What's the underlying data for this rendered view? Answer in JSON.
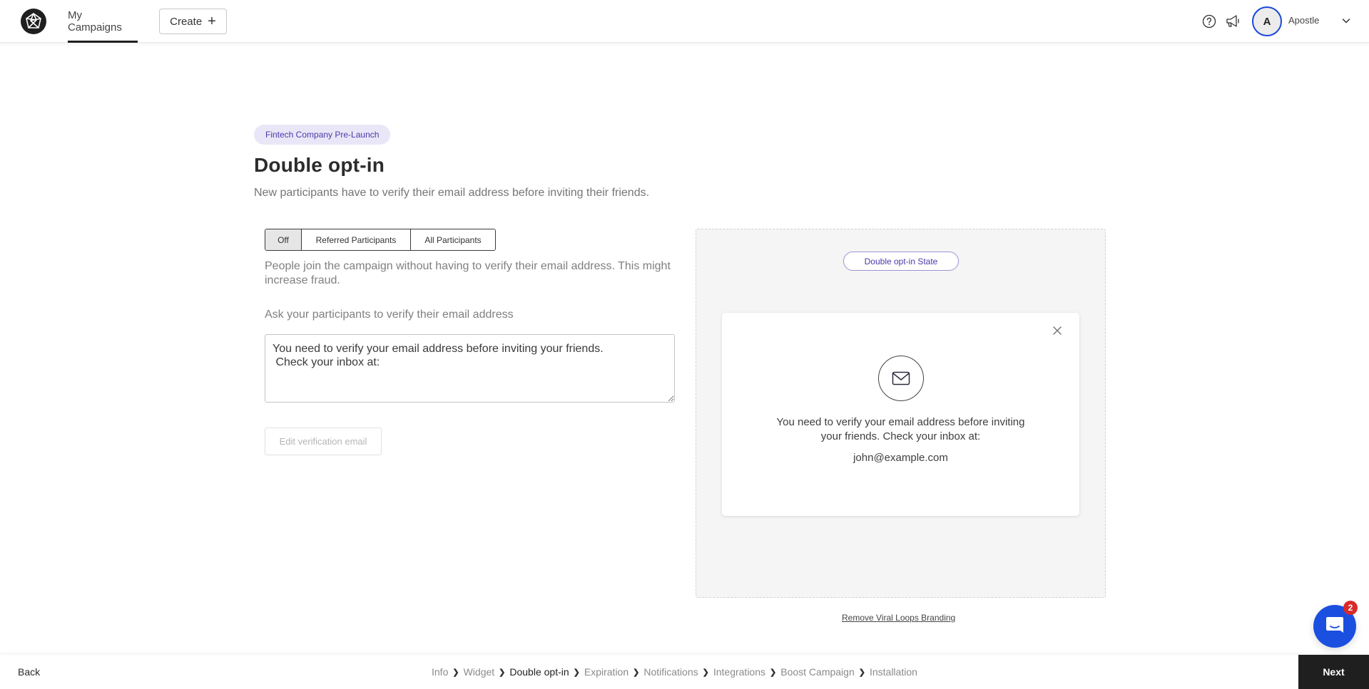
{
  "nav": {
    "logo": "viral-loops-logo",
    "active_tab": "My Campaigns",
    "create_label": "Create",
    "create_icon": "plus-icon",
    "help_icon": "question-circle-icon",
    "announcements_icon": "megaphone-icon",
    "user": {
      "initial": "A",
      "name": "Apostle",
      "menu_icon": "chevron-down-icon"
    }
  },
  "header": {
    "campaign_badge": "Fintech Company Pre-Launch",
    "title": "Double opt-in",
    "subtitle": "New participants have to verify their email address before inviting their friends."
  },
  "settings": {
    "mode_options": [
      {
        "label": "Off",
        "selected": true
      },
      {
        "label": "Referred Participants",
        "selected": false
      },
      {
        "label": "All Participants",
        "selected": false
      }
    ],
    "mode_description": "People join the campaign without having to verify their email address. This might increase fraud.",
    "message_label": "Ask your participants to verify their email address",
    "message_value": "You need to verify your email address before inviting your friends.\n Check your inbox at:",
    "edit_email_label": "Edit verification email",
    "edit_email_disabled": true
  },
  "preview": {
    "state_pill": "Double opt-in State",
    "card": {
      "close_icon": "close-icon",
      "mail_icon": "envelope-icon",
      "message": "You need to verify your email address before inviting your friends. Check your inbox at:",
      "email": "john@example.com"
    },
    "branding_link": "Remove Viral Loops Branding"
  },
  "chat": {
    "icon": "chat-icon",
    "unread_count": "2",
    "color": "#1b4fe0"
  },
  "footer": {
    "back_label": "Back",
    "next_label": "Next",
    "steps": [
      {
        "label": "Info",
        "current": false
      },
      {
        "label": "Widget",
        "current": false
      },
      {
        "label": "Double opt-in",
        "current": true
      },
      {
        "label": "Expiration",
        "current": false
      },
      {
        "label": "Notifications",
        "current": false
      },
      {
        "label": "Integrations",
        "current": false
      },
      {
        "label": "Boost Campaign",
        "current": false
      },
      {
        "label": "Installation",
        "current": false
      }
    ]
  },
  "colors": {
    "accent_purple": "#4a3aa8",
    "badge_bg": "#e9e7f7",
    "avatar_ring": "#1b47db",
    "dark": "#1f1f1f"
  }
}
